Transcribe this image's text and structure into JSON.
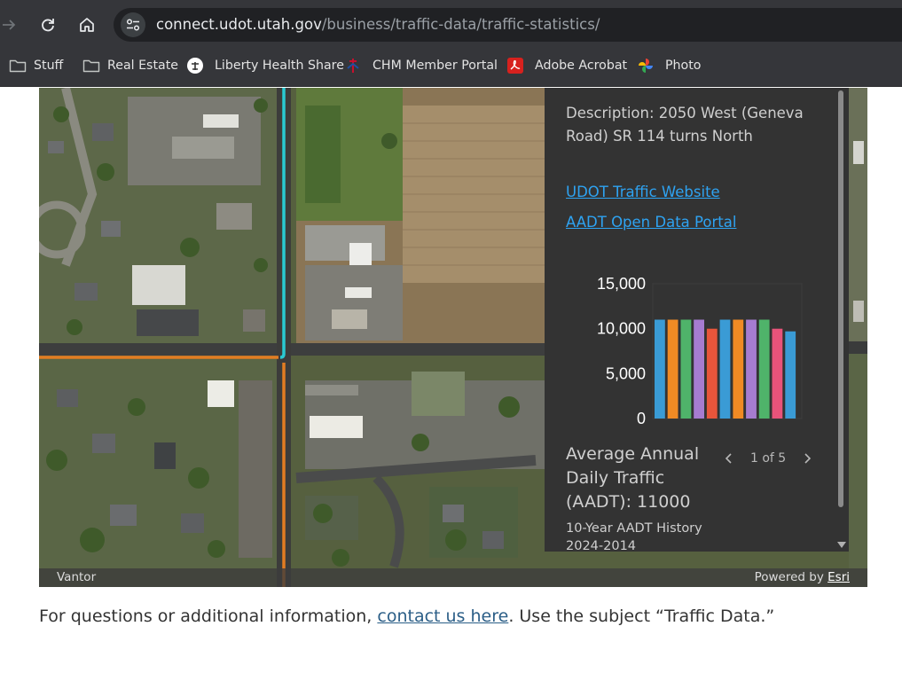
{
  "browser": {
    "url_host": "connect.udot.utah.gov",
    "url_path": "/business/traffic-data/traffic-statistics/",
    "bookmarks": [
      {
        "label": "Stuff",
        "icon": "folder-icon"
      },
      {
        "label": "Real Estate",
        "icon": "folder-icon"
      },
      {
        "label": "Liberty Health Share",
        "icon": "liberty-favicon"
      },
      {
        "label": "CHM Member Portal",
        "icon": "chm-favicon"
      },
      {
        "label": "Adobe Acrobat",
        "icon": "acrobat-favicon"
      },
      {
        "label": "Photo",
        "icon": "photos-favicon"
      }
    ]
  },
  "popup": {
    "description": "Description: 2050 West (Geneva Road) SR 114 turns North",
    "link_traffic": "UDOT Traffic Website",
    "link_portal": "AADT Open Data Portal",
    "aadt_label": "Average Annual Daily Traffic (AADT): 11000",
    "pager": "1 of 5",
    "history_title": "10-Year AADT History",
    "history_range": "2024-2014"
  },
  "chart_data": {
    "type": "bar",
    "title": "",
    "xlabel": "",
    "ylabel": "",
    "ylim": [
      0,
      15000
    ],
    "yticks": [
      "15,000",
      "10,000",
      "5,000",
      "0"
    ],
    "yticks_values": [
      15000,
      10000,
      5000,
      0
    ],
    "values": [
      11000,
      11000,
      11000,
      11000,
      10000,
      11000,
      11000,
      11000,
      11000,
      10000,
      9700
    ],
    "colors": [
      "#3a9bd5",
      "#f08a24",
      "#4fb36a",
      "#a67cd0",
      "#e8553b",
      "#3a9bd5",
      "#f08a24",
      "#a67cd0",
      "#4fb36a",
      "#e8537a",
      "#3a9bd5"
    ],
    "grid": false
  },
  "map": {
    "attribution_left": "Vantor",
    "powered_by": "Powered by ",
    "esri": "Esri"
  },
  "footer": {
    "before": "For questions or additional information, ",
    "link": "contact us here",
    "after": ". Use the subject “Traffic Data.”"
  }
}
